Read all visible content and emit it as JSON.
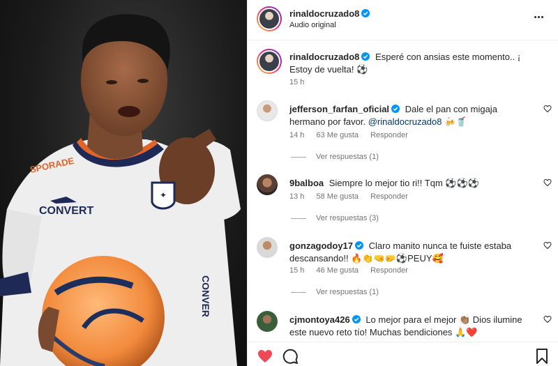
{
  "post": {
    "author": "rinaldocruzado8",
    "audio_label": "Audio original",
    "caption": "Esperé con ansias este momento.. ¡ Estoy de vuelta! ⚽",
    "caption_time": "15 h"
  },
  "photo": {
    "jersey_sponsor": "SPORADE",
    "jersey_brand": "CONVERT",
    "jersey_side": "CONVER"
  },
  "comments": [
    {
      "user": "jefferson_farfan_oficial",
      "verified": true,
      "text_before_mention": "Dale el pan con migaja hermano por favor. ",
      "mention": "@rinaldocruzado8",
      "text_after_mention": " 🍻🥤",
      "time": "14 h",
      "likes": "63 Me gusta",
      "reply_label": "Responder",
      "view_replies": "Ver respuestas (1)"
    },
    {
      "user": "9balboa",
      "verified": false,
      "text": "Siempre lo mejor tio ri!! Tqm ⚽⚽⚽",
      "time": "13 h",
      "likes": "58 Me gusta",
      "reply_label": "Responder",
      "view_replies": "Ver respuestas (3)"
    },
    {
      "user": "gonzagodoy17",
      "verified": true,
      "text": "Claro manito nunca te fuiste estaba descansando!! 🔥👏🤜🤛⚽PEUY🥰",
      "time": "15 h",
      "likes": "46 Me gusta",
      "reply_label": "Responder",
      "view_replies": "Ver respuestas (1)"
    },
    {
      "user": "cjmontoya426",
      "verified": true,
      "text": "Lo mejor para el mejor 👏🏽 Dios ilumine este nuevo reto tío! Muchas bendiciones 🙏❤️"
    }
  ],
  "icons": {
    "more": "more-icon",
    "verified": "verified-badge-icon",
    "like": "heart-icon",
    "comment": "comment-icon",
    "save": "bookmark-icon"
  },
  "colors": {
    "like_active": "#ed4956",
    "verified": "#0095f6",
    "mention": "#00376b",
    "muted": "#737373"
  }
}
